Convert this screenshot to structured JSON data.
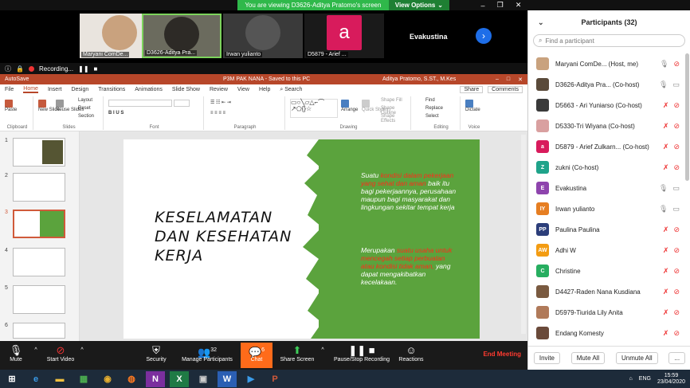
{
  "banner": {
    "text": "You are viewing D3626-Aditya Pratomo's screen",
    "view_options": "View Options"
  },
  "strip": {
    "tiles": [
      {
        "label": "Maryani ComDe..."
      },
      {
        "label": "D3626-Aditya Pra..."
      },
      {
        "label": "Irwan yulianto"
      },
      {
        "label": "D5879 - Arief ...",
        "initial": "a",
        "color": "#d81b5c"
      },
      {
        "label": "Evakustina"
      }
    ],
    "recording": "Recording..."
  },
  "ppt": {
    "autosave": "AutoSave",
    "title": "P3M PAK NANA - Saved to this PC",
    "user": "Aditya Pratomo, S.ST., M.Kes",
    "tabs": [
      "File",
      "Home",
      "Insert",
      "Design",
      "Transitions",
      "Animations",
      "Slide Show",
      "Review",
      "View",
      "Help"
    ],
    "search": "Search",
    "share": "Share",
    "comments": "Comments",
    "groups": [
      "Clipboard",
      "Slides",
      "Font",
      "Paragraph",
      "Drawing",
      "Editing",
      "Voice"
    ],
    "buttons": {
      "paste": "Paste",
      "new_slide": "New Slide",
      "reuse": "Reuse Slides",
      "layout": "Layout",
      "reset": "Reset",
      "section": "Section",
      "arrange": "Arrange",
      "quick_styles": "Quick Styles",
      "shape_fill": "Shape Fill",
      "shape_outline": "Shape Outline",
      "shape_effects": "Shape Effects",
      "find": "Find",
      "replace": "Replace",
      "select": "Select",
      "dictate": "Dictate"
    },
    "slide_numbers": [
      "1",
      "2",
      "3",
      "4",
      "5",
      "6"
    ],
    "slide": {
      "title_lines": [
        "KESELAMATAN",
        "DAN KESEHATAN",
        "KERJA"
      ],
      "p1": [
        {
          "t": "Suatu ",
          "red": false
        },
        {
          "t": "kondisi dalam pekerjaan yang sehat dan aman ",
          "red": true
        },
        {
          "t": "baik itu bagi pekerjaannya, perusahaan maupun bagi masyarakat dan lingkungan sekitar tempat kerja",
          "red": false
        }
      ],
      "p2": [
        {
          "t": "Merupakan ",
          "red": false
        },
        {
          "t": "suatu usaha untuk mencegah setiap perbuatan atau kondisi tidak aman, ",
          "red": true
        },
        {
          "t": "yang dapat mengakibatkan kecelakaan.",
          "red": false
        }
      ]
    }
  },
  "zoom": {
    "mute": "Mute",
    "start_video": "Start Video",
    "security": "Security",
    "manage": "Manage Participants",
    "manage_count": "32",
    "chat": "Chat",
    "chat_count": "6",
    "share": "Share Screen",
    "record": "Pause/Stop Recording",
    "reactions": "Reactions",
    "end": "End Meeting"
  },
  "panel": {
    "title": "Participants (32)",
    "search_placeholder": "Find a participant",
    "participants": [
      {
        "name": "Maryani ComDe... (Host, me)",
        "av": "",
        "color": "#c9a27e",
        "mic": "on",
        "cam": "off"
      },
      {
        "name": "D3626-Aditya Pra... (Co-host)",
        "av": "",
        "color": "#5a4a3a",
        "mic": "on",
        "cam": "on"
      },
      {
        "name": "D5663 - Ari Yuniarso (Co-host)",
        "av": "",
        "color": "#3a3a3a",
        "mic": "off",
        "cam": "off"
      },
      {
        "name": "D5330-Tri Wiyana (Co-host)",
        "av": "",
        "color": "#d9a0a0",
        "mic": "off",
        "cam": "off"
      },
      {
        "name": "D5879 - Arief Zulkarn... (Co-host)",
        "av": "a",
        "color": "#d81b5c",
        "mic": "off",
        "cam": "off"
      },
      {
        "name": "zukni (Co-host)",
        "av": "Z",
        "color": "#1fa38a",
        "mic": "off",
        "cam": "off"
      },
      {
        "name": "Evakustina",
        "av": "E",
        "color": "#8e44ad",
        "mic": "on",
        "cam": "on"
      },
      {
        "name": "Irwan yulianto",
        "av": "IY",
        "color": "#e67e22",
        "mic": "on",
        "cam": "on"
      },
      {
        "name": "Paulina Paulina",
        "av": "PP",
        "color": "#2c3e7a",
        "mic": "off",
        "cam": "off"
      },
      {
        "name": "Adhi W",
        "av": "AW",
        "color": "#f39c12",
        "mic": "off",
        "cam": "off"
      },
      {
        "name": "Christine",
        "av": "C",
        "color": "#27ae60",
        "mic": "off",
        "cam": "off"
      },
      {
        "name": "D4427-Raden Nana Kusdiana",
        "av": "",
        "color": "#7a5a40",
        "mic": "off",
        "cam": "off"
      },
      {
        "name": "D5979-Tiurida Lily Anita",
        "av": "",
        "color": "#b07a5a",
        "mic": "off",
        "cam": "off"
      },
      {
        "name": "Endang Komesty",
        "av": "",
        "color": "#6a4a3a",
        "mic": "off",
        "cam": "off"
      }
    ],
    "invite": "Invite",
    "mute_all": "Mute All",
    "unmute_all": "Unmute All",
    "more": "..."
  },
  "taskbar": {
    "lang": "ENG",
    "time": "15:59",
    "date": "23/04/2020"
  }
}
